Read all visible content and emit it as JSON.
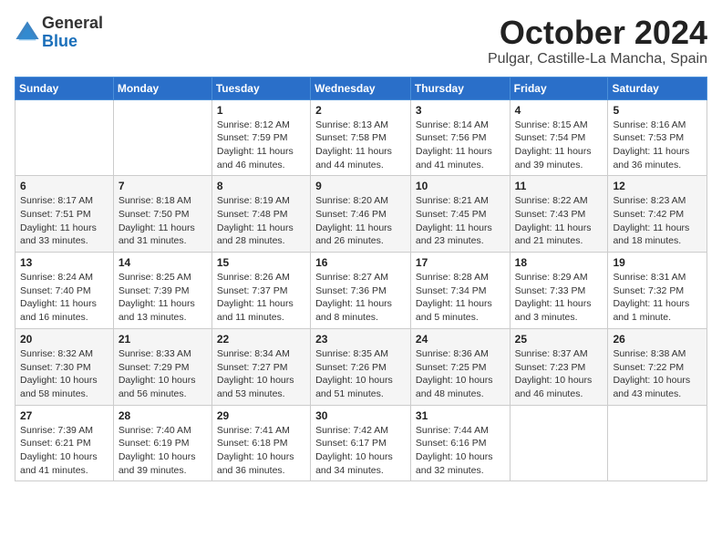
{
  "header": {
    "logo_general": "General",
    "logo_blue": "Blue",
    "month_title": "October 2024",
    "location": "Pulgar, Castille-La Mancha, Spain"
  },
  "days_of_week": [
    "Sunday",
    "Monday",
    "Tuesday",
    "Wednesday",
    "Thursday",
    "Friday",
    "Saturday"
  ],
  "weeks": [
    [
      {
        "day": "",
        "info": ""
      },
      {
        "day": "",
        "info": ""
      },
      {
        "day": "1",
        "info": "Sunrise: 8:12 AM\nSunset: 7:59 PM\nDaylight: 11 hours and 46 minutes."
      },
      {
        "day": "2",
        "info": "Sunrise: 8:13 AM\nSunset: 7:58 PM\nDaylight: 11 hours and 44 minutes."
      },
      {
        "day": "3",
        "info": "Sunrise: 8:14 AM\nSunset: 7:56 PM\nDaylight: 11 hours and 41 minutes."
      },
      {
        "day": "4",
        "info": "Sunrise: 8:15 AM\nSunset: 7:54 PM\nDaylight: 11 hours and 39 minutes."
      },
      {
        "day": "5",
        "info": "Sunrise: 8:16 AM\nSunset: 7:53 PM\nDaylight: 11 hours and 36 minutes."
      }
    ],
    [
      {
        "day": "6",
        "info": "Sunrise: 8:17 AM\nSunset: 7:51 PM\nDaylight: 11 hours and 33 minutes."
      },
      {
        "day": "7",
        "info": "Sunrise: 8:18 AM\nSunset: 7:50 PM\nDaylight: 11 hours and 31 minutes."
      },
      {
        "day": "8",
        "info": "Sunrise: 8:19 AM\nSunset: 7:48 PM\nDaylight: 11 hours and 28 minutes."
      },
      {
        "day": "9",
        "info": "Sunrise: 8:20 AM\nSunset: 7:46 PM\nDaylight: 11 hours and 26 minutes."
      },
      {
        "day": "10",
        "info": "Sunrise: 8:21 AM\nSunset: 7:45 PM\nDaylight: 11 hours and 23 minutes."
      },
      {
        "day": "11",
        "info": "Sunrise: 8:22 AM\nSunset: 7:43 PM\nDaylight: 11 hours and 21 minutes."
      },
      {
        "day": "12",
        "info": "Sunrise: 8:23 AM\nSunset: 7:42 PM\nDaylight: 11 hours and 18 minutes."
      }
    ],
    [
      {
        "day": "13",
        "info": "Sunrise: 8:24 AM\nSunset: 7:40 PM\nDaylight: 11 hours and 16 minutes."
      },
      {
        "day": "14",
        "info": "Sunrise: 8:25 AM\nSunset: 7:39 PM\nDaylight: 11 hours and 13 minutes."
      },
      {
        "day": "15",
        "info": "Sunrise: 8:26 AM\nSunset: 7:37 PM\nDaylight: 11 hours and 11 minutes."
      },
      {
        "day": "16",
        "info": "Sunrise: 8:27 AM\nSunset: 7:36 PM\nDaylight: 11 hours and 8 minutes."
      },
      {
        "day": "17",
        "info": "Sunrise: 8:28 AM\nSunset: 7:34 PM\nDaylight: 11 hours and 5 minutes."
      },
      {
        "day": "18",
        "info": "Sunrise: 8:29 AM\nSunset: 7:33 PM\nDaylight: 11 hours and 3 minutes."
      },
      {
        "day": "19",
        "info": "Sunrise: 8:31 AM\nSunset: 7:32 PM\nDaylight: 11 hours and 1 minute."
      }
    ],
    [
      {
        "day": "20",
        "info": "Sunrise: 8:32 AM\nSunset: 7:30 PM\nDaylight: 10 hours and 58 minutes."
      },
      {
        "day": "21",
        "info": "Sunrise: 8:33 AM\nSunset: 7:29 PM\nDaylight: 10 hours and 56 minutes."
      },
      {
        "day": "22",
        "info": "Sunrise: 8:34 AM\nSunset: 7:27 PM\nDaylight: 10 hours and 53 minutes."
      },
      {
        "day": "23",
        "info": "Sunrise: 8:35 AM\nSunset: 7:26 PM\nDaylight: 10 hours and 51 minutes."
      },
      {
        "day": "24",
        "info": "Sunrise: 8:36 AM\nSunset: 7:25 PM\nDaylight: 10 hours and 48 minutes."
      },
      {
        "day": "25",
        "info": "Sunrise: 8:37 AM\nSunset: 7:23 PM\nDaylight: 10 hours and 46 minutes."
      },
      {
        "day": "26",
        "info": "Sunrise: 8:38 AM\nSunset: 7:22 PM\nDaylight: 10 hours and 43 minutes."
      }
    ],
    [
      {
        "day": "27",
        "info": "Sunrise: 7:39 AM\nSunset: 6:21 PM\nDaylight: 10 hours and 41 minutes."
      },
      {
        "day": "28",
        "info": "Sunrise: 7:40 AM\nSunset: 6:19 PM\nDaylight: 10 hours and 39 minutes."
      },
      {
        "day": "29",
        "info": "Sunrise: 7:41 AM\nSunset: 6:18 PM\nDaylight: 10 hours and 36 minutes."
      },
      {
        "day": "30",
        "info": "Sunrise: 7:42 AM\nSunset: 6:17 PM\nDaylight: 10 hours and 34 minutes."
      },
      {
        "day": "31",
        "info": "Sunrise: 7:44 AM\nSunset: 6:16 PM\nDaylight: 10 hours and 32 minutes."
      },
      {
        "day": "",
        "info": ""
      },
      {
        "day": "",
        "info": ""
      }
    ]
  ]
}
